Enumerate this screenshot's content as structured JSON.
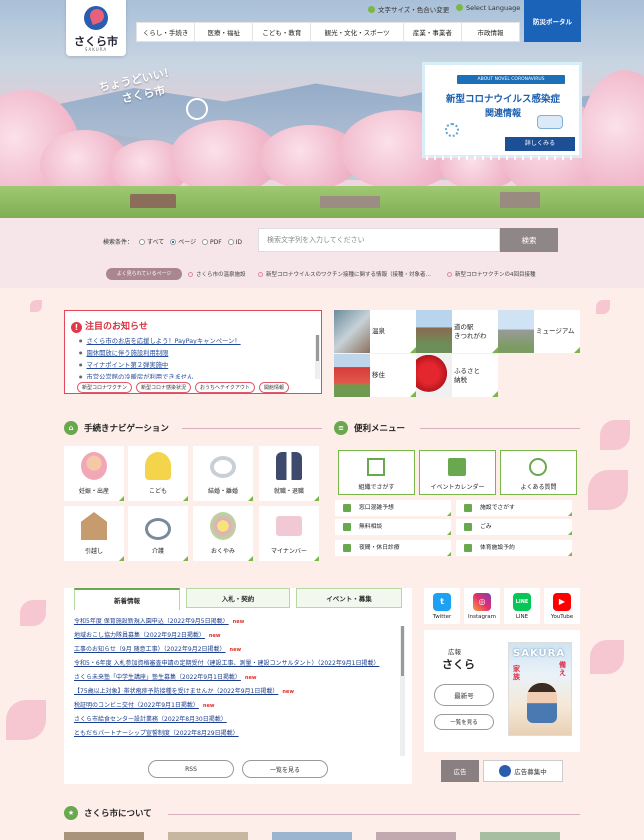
{
  "header": {
    "logo_name": "さくら市",
    "logo_en": "SAKURA",
    "text_size_link": "文字サイズ・色合い変更",
    "language_link": "Select Language",
    "disaster_portal": "防災ポータル",
    "nav": [
      "くらし・手続き",
      "医療・福祉",
      "こども・教育",
      "観光・文化・スポーツ",
      "産業・事業者",
      "市政情報"
    ]
  },
  "hero": {
    "catch_line1": "ちょうどいい！",
    "catch_line2": "さくら市"
  },
  "corona_banner": {
    "tag": "ABOUT NOVEL CORONAVIRUS",
    "title1": "新型コロナウイルス感染症",
    "title2": "関連情報",
    "more": "詳しくみる"
  },
  "search": {
    "condition_label": "検索条件：",
    "options": [
      "すべて",
      "ページ",
      "PDF",
      "ID"
    ],
    "selected": "ページ",
    "placeholder": "検索文字列を入力してください",
    "button": "検索",
    "popular_label": "よく見られているページ",
    "popular": [
      "さくら市の温泉施設",
      "新型コロナウイルスのワクチン接種に関する情報（接種・対象者…",
      "新型コロナワクチンの4回目接種"
    ]
  },
  "notice": {
    "title": "注目のお知らせ",
    "items": [
      "さくら市のお店を応援しよう！PayPayキャンペーン！",
      "園休開放に伴う施設利用制限",
      "マイナポイント第２弾実施中",
      "市営公営館の冷暖房が利用できません"
    ],
    "tags": [
      "新型コロナワクチン",
      "新型コロナ感染状況",
      "おうちへテイクアウト",
      "開館情報"
    ]
  },
  "tiles": [
    {
      "label": "温泉"
    },
    {
      "label": "道の駅\nきつれがわ"
    },
    {
      "label": "ミュージアム"
    },
    {
      "label": "移住"
    },
    {
      "label": "ふるさと\n納税"
    }
  ],
  "procedure_nav": {
    "title": "手続きナビゲーション",
    "items": [
      "妊娠・出産",
      "こども",
      "結婚・離婚",
      "就職・退職",
      "引越し",
      "介護",
      "おくやみ",
      "マイナンバー"
    ]
  },
  "convenience": {
    "title": "便利メニュー",
    "big": [
      "組織でさがす",
      "イベントカレンダー",
      "よくある質問"
    ],
    "small": [
      "窓口混雑予想",
      "施設でさがす",
      "無料相談",
      "ごみ",
      "夜間・休日診療",
      "体育施設予約"
    ]
  },
  "news": {
    "tabs": [
      "新着情報",
      "入札・契約",
      "イベント・募集"
    ],
    "items": [
      {
        "text": "令和5年度 保育施設新規入園申込（2022年9月5日掲載）",
        "new": true
      },
      {
        "text": "地域おこし協力隊員募集（2022年9月2日掲載）",
        "new": true
      },
      {
        "text": "工事のお知らせ（9月 随意工事）（2022年9月2日掲載）",
        "new": true
      },
      {
        "text": "令和5・6年度 入札参加資格審査申請の定期受付（建設工事、測量・建設コンサルタント）（2022年9月1日掲載）",
        "new": false
      },
      {
        "text": "さくら未来塾「中学生講座」塾生募集（2022年9月1日掲載）",
        "new": true
      },
      {
        "text": "【75歳以上対象】帯状疱疹予防接種を受けませんか（2022年9月1日掲載）",
        "new": true
      },
      {
        "text": "税証明のコンビニ交付（2022年9月1日掲載）",
        "new": true
      },
      {
        "text": "さくら市給食センター設計業務（2022年8月30日掲載）",
        "new": false
      },
      {
        "text": "ともだちパートナーシップ宣誓制度（2022年8月29日掲載）",
        "new": false
      }
    ],
    "new_label": "new",
    "rss": "RSS",
    "list_all": "一覧を見る"
  },
  "sns": [
    "Twitter",
    "Instagram",
    "LINE",
    "YouTube"
  ],
  "magazine": {
    "label1": "広報",
    "label2": "さくら",
    "latest": "最新号",
    "list": "一覧を見る",
    "cover_title": "SAKURA",
    "cover_side1": "家族",
    "cover_side2": "備え"
  },
  "ads": {
    "label": "広告",
    "recruit": "広告募集中"
  },
  "about": {
    "title": "さくら市について"
  },
  "colors": {
    "accent_green": "#6aa84f",
    "notice_red": "#e24a5c",
    "portal_blue": "#1b63b9",
    "background_pink": "#fdeee9"
  }
}
